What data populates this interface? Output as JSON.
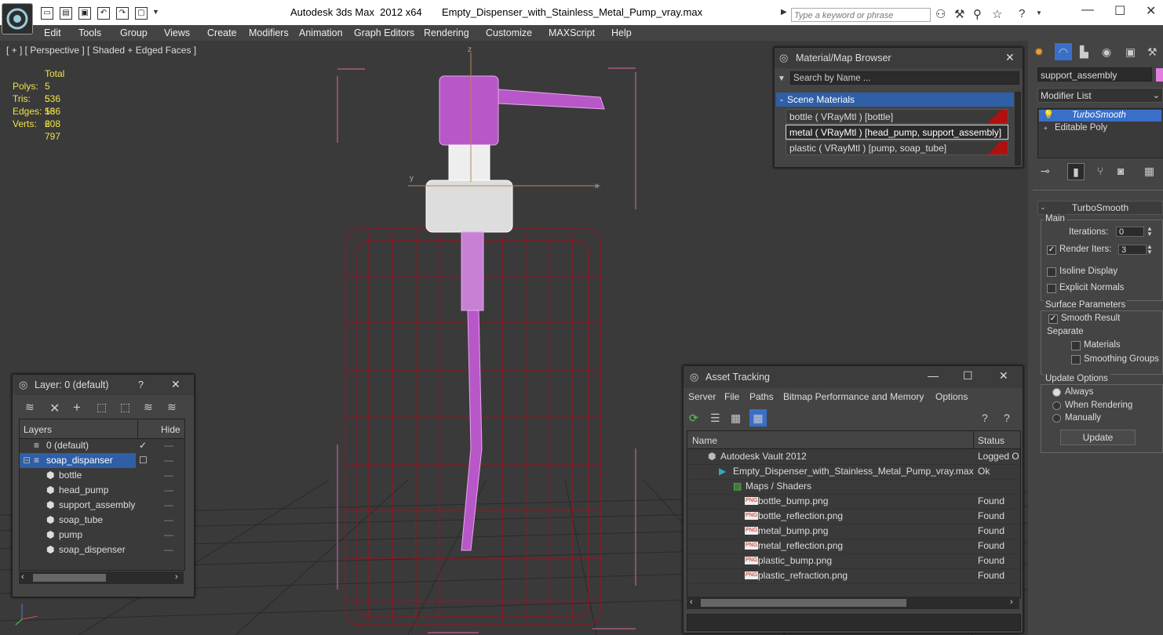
{
  "window": {
    "title": "Autodesk 3ds Max  2012 x64       Empty_Dispenser_with_Stainless_Metal_Pump_vray.max",
    "search_placeholder": "Type a keyword or phrase"
  },
  "menu": [
    "Edit",
    "Tools",
    "Group",
    "Views",
    "Create",
    "Modifiers",
    "Animation",
    "Graph Editors",
    "Rendering",
    "Customize",
    "MAXScript",
    "Help"
  ],
  "viewport": {
    "label": "[ + ] [ Perspective ] [ Shaded + Edged Faces ]",
    "stats": {
      "header": "Total",
      "rows": [
        {
          "k": "Polys:",
          "v": "5 536"
        },
        {
          "k": "Tris:",
          "v": "5 536"
        },
        {
          "k": "Edges:",
          "v": "16 608"
        },
        {
          "k": "Verts:",
          "v": "2 797"
        }
      ]
    },
    "axis_labels": {
      "z": "z",
      "x": "x",
      "y": "y"
    }
  },
  "material_browser": {
    "title": "Material/Map Browser",
    "search": "Search by Name ...",
    "section": "Scene Materials",
    "items": [
      "bottle  ( VRayMtl )  [bottle]",
      "metal  ( VRayMtl )  [head_pump, support_assembly]",
      "plastic  ( VRayMtl )  [pump, soap_tube]"
    ],
    "swatch_color": "#b01010"
  },
  "layer_window": {
    "title": "Layer: 0 (default)",
    "help": "?",
    "col_layers": "Layers",
    "col_hide": "Hide",
    "rows": [
      {
        "name": "0 (default)",
        "indent": 1
      },
      {
        "name": "soap_dispanser",
        "indent": 1
      },
      {
        "name": "bottle",
        "indent": 2
      },
      {
        "name": "head_pump",
        "indent": 2
      },
      {
        "name": "support_assembly",
        "indent": 2
      },
      {
        "name": "soap_tube",
        "indent": 2
      },
      {
        "name": "pump",
        "indent": 2
      },
      {
        "name": "soap_dispenser",
        "indent": 2
      }
    ]
  },
  "asset_tracking": {
    "title": "Asset Tracking",
    "menu": [
      "Server",
      "File",
      "Paths",
      "Bitmap Performance and Memory",
      "Options"
    ],
    "col_name": "Name",
    "col_status": "Status",
    "rows": [
      {
        "name": "Autodesk Vault 2012",
        "status": "Logged O"
      },
      {
        "name": "Empty_Dispenser_with_Stainless_Metal_Pump_vray.max",
        "status": "Ok"
      },
      {
        "name": "Maps / Shaders",
        "status": ""
      },
      {
        "name": "bottle_bump.png",
        "status": "Found"
      },
      {
        "name": "bottle_reflection.png",
        "status": "Found"
      },
      {
        "name": "metal_bump.png",
        "status": "Found"
      },
      {
        "name": "metal_reflection.png",
        "status": "Found"
      },
      {
        "name": "plastic_bump.png",
        "status": "Found"
      },
      {
        "name": "plastic_refraction.png",
        "status": "Found"
      }
    ],
    "png_badge": "PNG"
  },
  "command_panel": {
    "object_name": "support_assembly",
    "modifier_list": "Modifier List",
    "stack": [
      "TurboSmooth",
      "Editable Poly"
    ],
    "rollout_title": "TurboSmooth",
    "main": "Main",
    "iterations_label": "Iterations:",
    "iterations_value": "0",
    "render_iters_label": "Render Iters:",
    "render_iters_value": "3",
    "isoline": "Isoline Display",
    "explicit_normals": "Explicit Normals",
    "surface_params": "Surface Parameters",
    "smooth_result": "Smooth Result",
    "separate": "Separate",
    "materials": "Materials",
    "smoothing_groups": "Smoothing Groups",
    "update_options": "Update Options",
    "always": "Always",
    "when_rendering": "When Rendering",
    "manually": "Manually",
    "update_btn": "Update"
  }
}
